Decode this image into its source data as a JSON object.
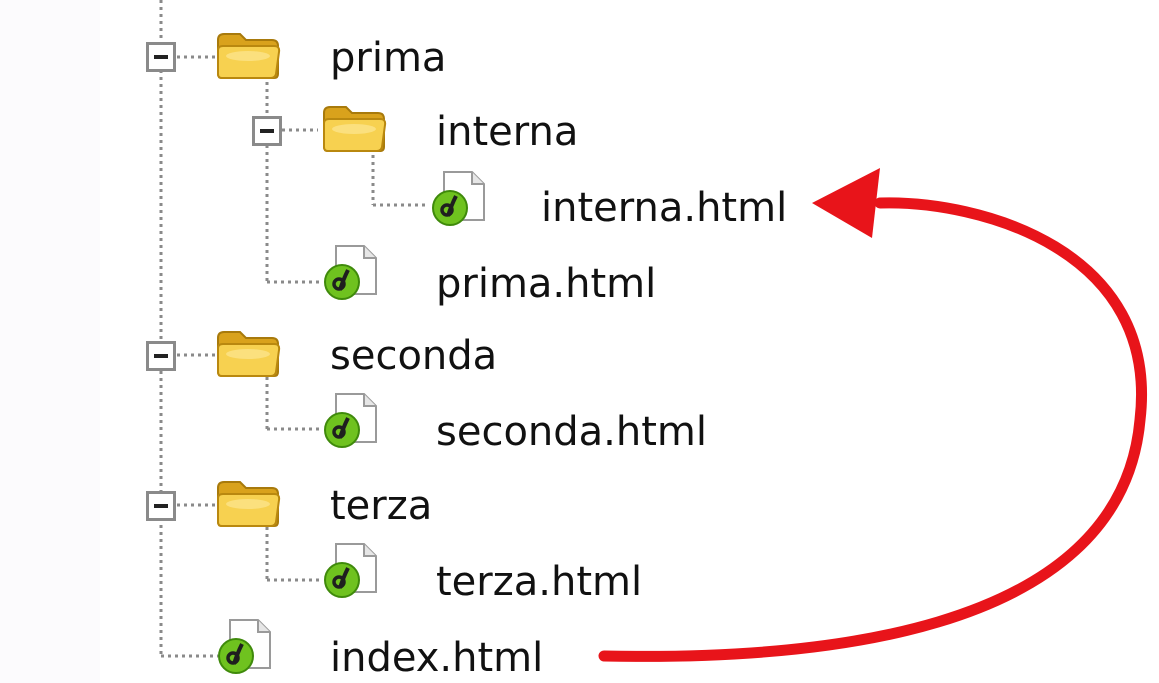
{
  "tree": {
    "folder_prima": {
      "label": "prima",
      "icon": "folder-icon",
      "expanded": true
    },
    "folder_interna": {
      "label": "interna",
      "icon": "folder-icon",
      "expanded": true
    },
    "file_interna_html": {
      "label": "interna.html",
      "icon": "dreamweaver-file-icon"
    },
    "file_prima_html": {
      "label": "prima.html",
      "icon": "dreamweaver-file-icon"
    },
    "folder_seconda": {
      "label": "seconda",
      "icon": "folder-icon",
      "expanded": true
    },
    "file_seconda_html": {
      "label": "seconda.html",
      "icon": "dreamweaver-file-icon"
    },
    "folder_terza": {
      "label": "terza",
      "icon": "folder-icon",
      "expanded": true
    },
    "file_terza_html": {
      "label": "terza.html",
      "icon": "dreamweaver-file-icon"
    },
    "file_index_html": {
      "label": "index.html",
      "icon": "dreamweaver-file-icon"
    }
  },
  "annotation": {
    "arrow_color": "#e8141a",
    "from": "index.html",
    "to": "interna.html"
  },
  "colors": {
    "folder": "#f4c430",
    "dw_badge": "#6fc21f",
    "tree_line": "#8a8a8a"
  }
}
